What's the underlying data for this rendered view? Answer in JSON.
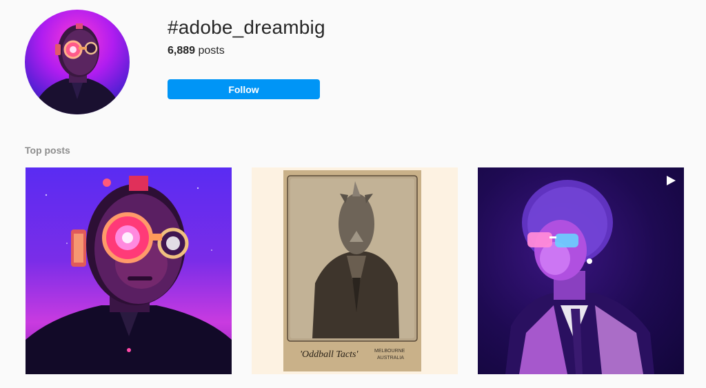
{
  "header": {
    "hashtag": "#adobe_dreambig",
    "post_count": "6,889",
    "post_count_suffix": " posts",
    "follow_label": "Follow"
  },
  "top_posts": {
    "section_title": "Top posts",
    "posts": [
      {
        "kind": "image",
        "icon": "cyborg-portrait-image"
      },
      {
        "kind": "image",
        "icon": "rhino-portrait-image",
        "caption": "'Oddball Tacts'",
        "location_line1": "MELBOURNE",
        "location_line2": "AUSTRALIA"
      },
      {
        "kind": "video",
        "icon": "play-icon"
      }
    ]
  },
  "colors": {
    "follow_button": "#0095f6",
    "background": "#fafafa",
    "muted_text": "#8e8e8e"
  }
}
